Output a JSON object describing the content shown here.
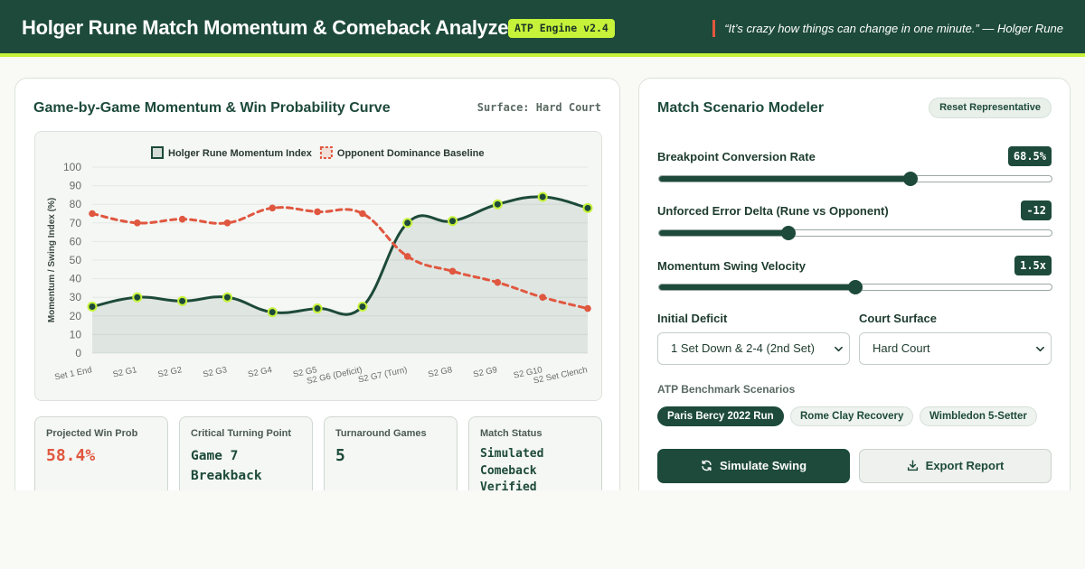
{
  "header": {
    "title": "Holger Rune Match Momentum & Comeback Analyzer",
    "version_badge": "ATP Engine v2.4",
    "quote": "“It’s crazy how things can change in one minute.” — Holger Rune"
  },
  "colors": {
    "brand_green": "#1d4a3a",
    "accent_lime": "#c6f23a",
    "alert_red": "#e0573f"
  },
  "chart_panel": {
    "title": "Game-by-Game Momentum & Win Probability Curve",
    "surface_label": "Surface: Hard Court"
  },
  "chart_data": {
    "type": "line",
    "categories": [
      "Set 1 End",
      "S2 G1",
      "S2 G2",
      "S2 G3",
      "S2 G4",
      "S2 G5",
      "S2 G6 (Deficit)",
      "S2 G7 (Turn)",
      "S2 G8",
      "S2 G9",
      "S2 G10",
      "S2 Set Clench"
    ],
    "series": [
      {
        "name": "Holger Rune Momentum Index",
        "values": [
          25,
          30,
          28,
          30,
          22,
          24,
          25,
          70,
          71,
          80,
          84,
          78
        ],
        "color": "#1d4a3a",
        "point_color": "#c6f23a",
        "style": "solid",
        "filled": true
      },
      {
        "name": "Opponent Dominance Baseline",
        "values": [
          75,
          70,
          72,
          70,
          78,
          76,
          75,
          52,
          44,
          38,
          30,
          24
        ],
        "color": "#e0573f",
        "style": "dashed",
        "filled": false
      }
    ],
    "ylabel": "Momentum / Swing Index (%)",
    "xlabel": "",
    "ylim": [
      0,
      100
    ],
    "yticks": [
      0,
      10,
      20,
      30,
      40,
      50,
      60,
      70,
      80,
      90,
      100
    ],
    "grid": true,
    "legend_position": "top-center"
  },
  "stats": [
    {
      "label": "Projected Win Prob",
      "value": "58.4%"
    },
    {
      "label": "Critical Turning Point",
      "value": "Game 7 Breakback"
    },
    {
      "label": "Turnaround Games",
      "value": "5"
    },
    {
      "label": "Match Status",
      "value": "Simulated Comeback Verified"
    }
  ],
  "modeler": {
    "title": "Match Scenario Modeler",
    "reset_label": "Reset Representative",
    "sliders": [
      {
        "label": "Breakpoint Conversion Rate",
        "display": "68.5%",
        "fraction": 0.64
      },
      {
        "label": "Unforced Error Delta (Rune vs Opponent)",
        "display": "-12",
        "fraction": 0.33
      },
      {
        "label": "Momentum Swing Velocity",
        "display": "1.5x",
        "fraction": 0.5
      }
    ],
    "initial_deficit": {
      "label": "Initial Deficit",
      "selected": "1 Set Down & 2-4 (2nd Set)"
    },
    "court_surface": {
      "label": "Court Surface",
      "selected": "Hard Court"
    },
    "benchmark_label": "ATP Benchmark Scenarios",
    "benchmarks": [
      "Paris Bercy 2022 Run",
      "Rome Clay Recovery",
      "Wimbledon 5-Setter"
    ],
    "active_benchmark": "Paris Bercy 2022 Run",
    "simulate_label": "Simulate Swing",
    "export_label": "Export Report",
    "icons": {
      "simulate": "refresh-icon",
      "export": "download-icon"
    }
  }
}
